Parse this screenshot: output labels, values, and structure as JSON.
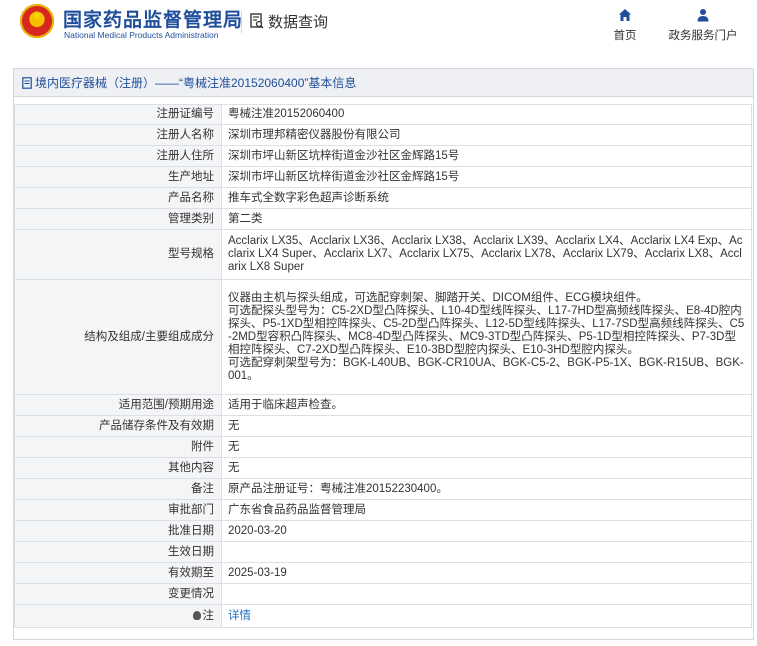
{
  "header": {
    "brand_cn": "国家药品监督管理局",
    "brand_en": "National Medical Products Administration",
    "data_query": "数据查询",
    "nav_home": "首页",
    "nav_portal": "政务服务门户",
    "brand_color": "#1f4e9b"
  },
  "panel": {
    "title": "境内医疗器械（注册）——“粤械注准20152060400”基本信息"
  },
  "rows": [
    {
      "label": "注册证编号",
      "value": "粤械注准20152060400"
    },
    {
      "label": "注册人名称",
      "value": "深圳市理邦精密仪器股份有限公司"
    },
    {
      "label": "注册人住所",
      "value": "深圳市坪山新区坑梓街道金沙社区金辉路15号"
    },
    {
      "label": "生产地址",
      "value": "深圳市坪山新区坑梓街道金沙社区金辉路15号"
    },
    {
      "label": "产品名称",
      "value": "推车式全数字彩色超声诊断系统"
    },
    {
      "label": "管理类别",
      "value": "第二类"
    },
    {
      "label": "型号规格",
      "value": "Acclarix LX35、Acclarix LX36、Acclarix LX38、Acclarix LX39、Acclarix LX4、Acclarix LX4 Exp、Acclarix LX4 Super、Acclarix LX7、Acclarix LX75、Acclarix LX78、Acclarix LX79、Acclarix LX8、Acclarix LX8 Super"
    },
    {
      "label": "结构及组成/主要组成成分",
      "value": "仪器由主机与探头组成，可选配穿刺架、脚踏开关、DICOM组件、ECG模块组件。\n可选配探头型号为：C5-2XD型凸阵探头、L10-4D型线阵探头、L17-7HD型高频线阵探头、E8-4D腔内探头、P5-1XD型相控阵探头、C5-2D型凸阵探头、L12-5D型线阵探头、L17-7SD型高频线阵探头、C5-2MD型容积凸阵探头、MC8-4D型凸阵探头、MC9-3TD型凸阵探头、P5-1D型相控阵探头、P7-3D型相控阵探头、C7-2XD型凸阵探头、E10-3BD型腔内探头、E10-3HD型腔内探头。\n可选配穿刺架型号为：BGK-L40UB、BGK-CR10UA、BGK-C5-2、BGK-P5-1X、BGK-R15UB、BGK-001。"
    },
    {
      "label": "适用范围/预期用途",
      "value": "适用于临床超声检查。"
    },
    {
      "label": "产品储存条件及有效期",
      "value": "无"
    },
    {
      "label": "附件",
      "value": "无"
    },
    {
      "label": "其他内容",
      "value": "无"
    },
    {
      "label": "备注",
      "value": "原产品注册证号：粤械注准20152230400。"
    },
    {
      "label": "审批部门",
      "value": "广东省食品药品监督管理局"
    },
    {
      "label": "批准日期",
      "value": "2020-03-20"
    },
    {
      "label": "生效日期",
      "value": ""
    },
    {
      "label": "有效期至",
      "value": "2025-03-19"
    },
    {
      "label": "变更情况",
      "value": ""
    }
  ],
  "note": {
    "label": "注",
    "link": "详情"
  }
}
